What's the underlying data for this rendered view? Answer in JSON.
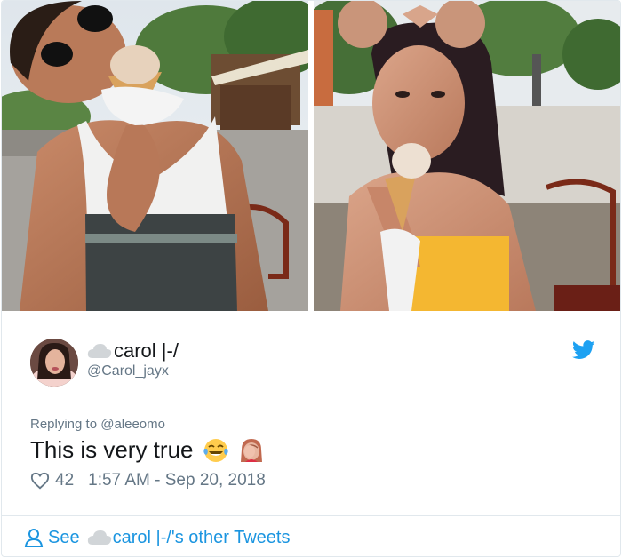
{
  "tweet": {
    "author": {
      "name": "carol |-/",
      "handle": "@Carol_jayx",
      "name_icon": "cloud-icon",
      "avatar": "profile-photo"
    },
    "platform_icon": "twitter-bird-icon",
    "reply_context": "Replying to @aleeomo",
    "text": "This is very true",
    "emojis": [
      "face-with-tears-of-joy",
      "woman-facepalming"
    ],
    "likes": "42",
    "timestamp": "1:57 AM - Sep 20, 2018",
    "footer": {
      "see": "See",
      "name": "carol |-/",
      "suffix": "'s other Tweets"
    }
  },
  "colors": {
    "link": "#1b95e0",
    "muted": "#657786",
    "text": "#14171a",
    "border": "#e1e8ed",
    "twitter_blue": "#1da1f2"
  }
}
